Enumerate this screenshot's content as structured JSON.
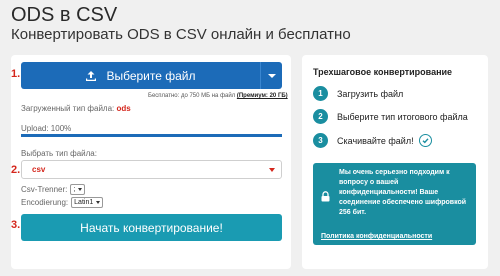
{
  "header": {
    "title": "ODS в CSV",
    "subtitle": "Конвертировать ODS в CSV онлайн и бесплатно"
  },
  "steps_markers": [
    "1.",
    "2.",
    "3."
  ],
  "upload": {
    "choose_label": "Выберите файл",
    "limit_text": "Бесплатно: до 750 МБ на файл",
    "premium_text": "(Премиум: 20 ГБ)",
    "loaded_type_label": "Загруженный тип файла:",
    "loaded_type_value": "ods",
    "progress_label": "Upload: 100%",
    "progress_value": 1.0
  },
  "target": {
    "label": "Выбрать тип файла:",
    "value": "csv"
  },
  "options": {
    "separator_label": "Csv-Trenner:",
    "separator_value": ";",
    "encoding_label": "Encodierung:",
    "encoding_value": "Latin1"
  },
  "convert_label": "Начать конвертирование!",
  "howto": {
    "title": "Трехшаговое конвертирование",
    "steps": [
      {
        "num": "1",
        "text": "Загрузить файл"
      },
      {
        "num": "2",
        "text": "Выберите тип итогового файла"
      },
      {
        "num": "3",
        "text": "Скачивайте файл!"
      }
    ]
  },
  "privacy": {
    "text": "Мы очень серьезно подходим к вопросу о вашей конфиденциальности! Ваше соединение обеспечено шифровкой 256 бит.",
    "link": "Политика конфиденциальности"
  },
  "colors": {
    "primary": "#1c6bb8",
    "accent": "#1a9bb2",
    "teal": "#1a8ea0",
    "red": "#d4261c"
  }
}
